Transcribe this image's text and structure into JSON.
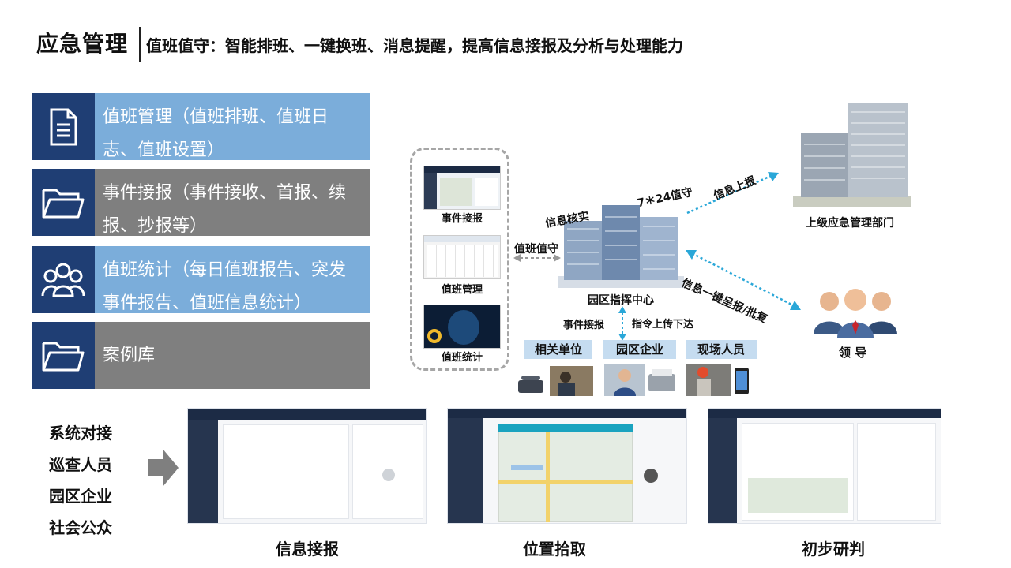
{
  "header": {
    "title": "应急管理",
    "subtitle": "值班值守：智能排班、一键换班、消息提醒，提高信息接报及分析与处理能力"
  },
  "menu": [
    {
      "icon": "document-icon",
      "text": "值班管理（值班排班、值班日志、值班设置）",
      "color": "#7badda"
    },
    {
      "icon": "folder-icon",
      "text": "事件接报（事件接收、首报、续报、抄报等）",
      "color": "#7f7f7f"
    },
    {
      "icon": "people-group-icon",
      "text": "值班统计（每日值班报告、突发事件报告、值班信息统计）",
      "color": "#7badda"
    },
    {
      "icon": "folder-icon",
      "text": "案例库",
      "color": "#7f7f7f"
    }
  ],
  "sources": [
    "系统对接",
    "巡查人员",
    "园区企业",
    "社会公众"
  ],
  "diagram": {
    "panel_captions": [
      "事件接报",
      "值班管理",
      "值班统计"
    ],
    "duty_label": "值班值守",
    "center_label": "园区指挥中心",
    "verify_label": "信息核实",
    "hours_label": "7＊24值守",
    "report_up_label": "信息上报",
    "upper_dept_label": "上级应急管理部门",
    "leader_report_label": "信息一键呈报/批复",
    "leader_label": "领 导",
    "event_report_label": "事件接报",
    "command_label": "指令上传下达",
    "units": [
      "相关单位",
      "园区企业",
      "现场人员"
    ]
  },
  "screenshots": [
    {
      "caption": "信息接报"
    },
    {
      "caption": "位置拾取"
    },
    {
      "caption": "初步研判"
    }
  ],
  "colors": {
    "navy": "#1f3e74",
    "light_blue": "#7badda",
    "gray": "#7f7f7f",
    "label_bg": "#c5dcf0",
    "arrow_blue": "#2aa7d8"
  }
}
